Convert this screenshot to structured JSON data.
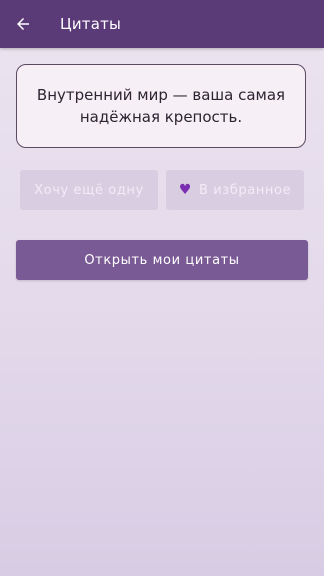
{
  "app_bar": {
    "title": "Цитаты",
    "back_icon": "arrow-left-icon",
    "background": "#5b3a78"
  },
  "quote": {
    "text": "Внутренний мир — ваша самая надёжная крепость."
  },
  "actions": {
    "more_label": "Хочу ещё одну",
    "favorite_label": "В избранное",
    "favorite_icon": "purple-heart-icon",
    "open_label": "Открыть мои цитаты"
  },
  "colors": {
    "primary_button": "#7a5a94",
    "secondary_button": "#d9cde2",
    "heart": "#7a2fb0"
  }
}
